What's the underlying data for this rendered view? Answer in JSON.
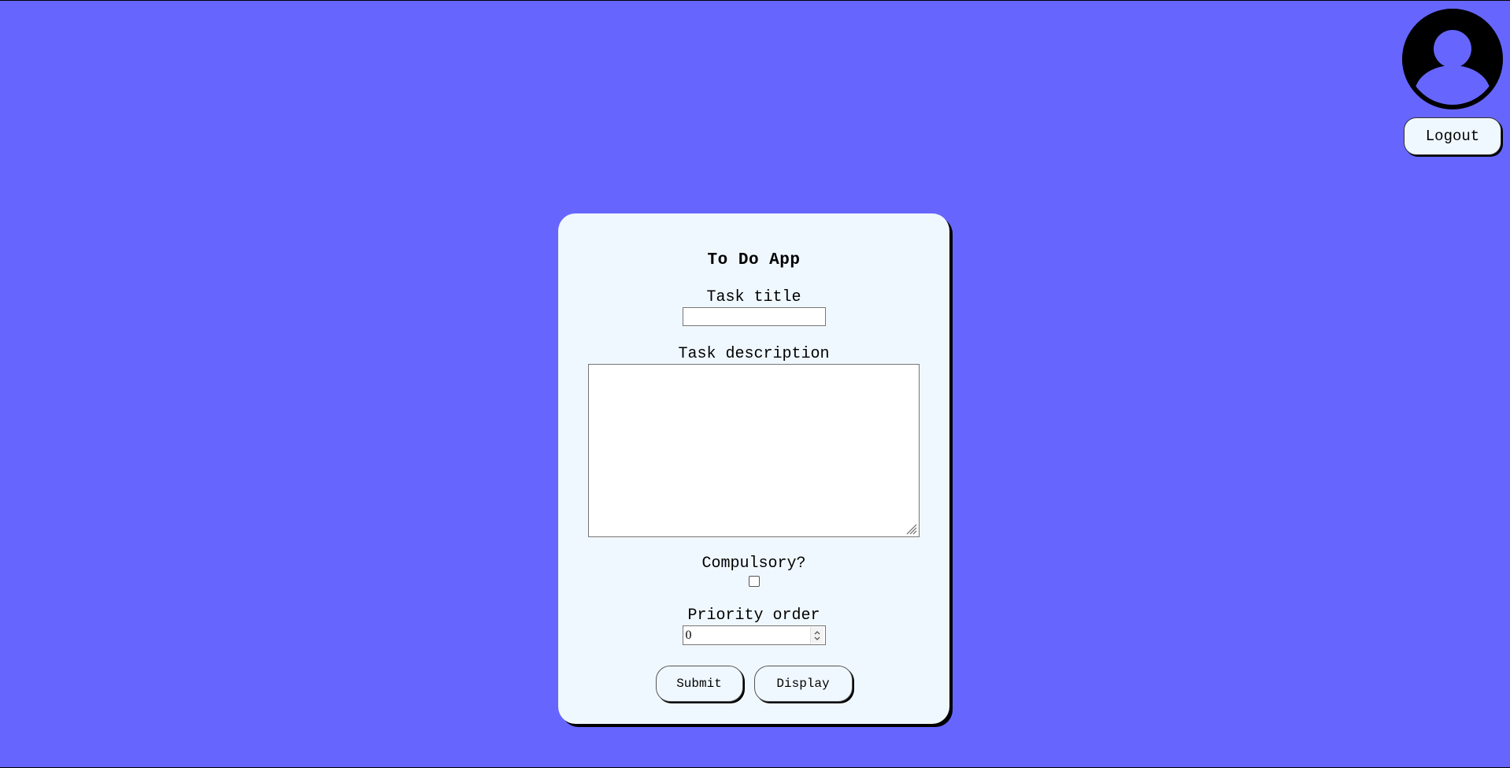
{
  "header": {
    "logout_label": "Logout"
  },
  "form": {
    "title": "To Do App",
    "task_title_label": "Task title",
    "task_title_value": "",
    "task_description_label": "Task description",
    "task_description_value": "",
    "compulsory_label": "Compulsory?",
    "compulsory_checked": false,
    "priority_label": "Priority order",
    "priority_value": "0",
    "submit_label": "Submit",
    "display_label": "Display"
  },
  "colors": {
    "background": "#6666ff",
    "card": "#f0f8ff"
  },
  "icons": {
    "avatar": "user-avatar-icon",
    "resize": "resize-grip-icon",
    "spinner": "spinner-icon"
  }
}
